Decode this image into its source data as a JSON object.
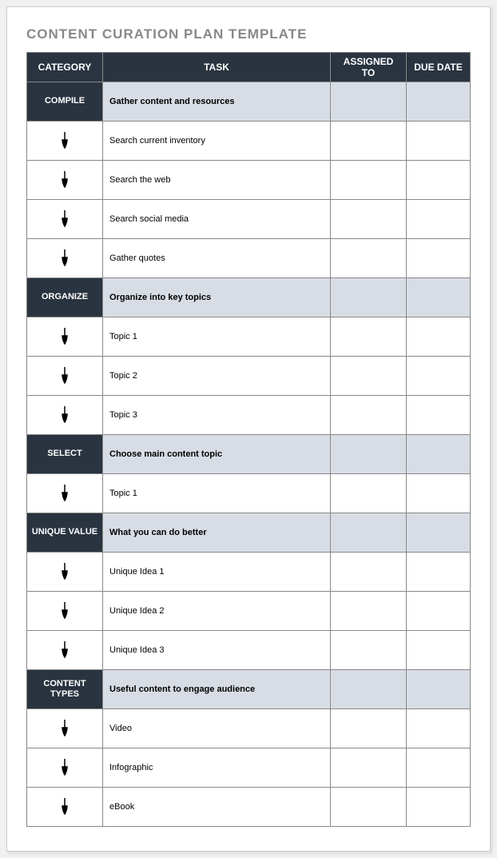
{
  "title": "CONTENT CURATION PLAN TEMPLATE",
  "columns": {
    "category": "CATEGORY",
    "task": "TASK",
    "assigned": "ASSIGNED TO",
    "due": "DUE DATE"
  },
  "sections": [
    {
      "category": "COMPILE",
      "header": "Gather content and resources",
      "rows": [
        {
          "task": "Search current inventory",
          "assigned": "",
          "due": ""
        },
        {
          "task": "Search the web",
          "assigned": "",
          "due": ""
        },
        {
          "task": "Search social media",
          "assigned": "",
          "due": ""
        },
        {
          "task": "Gather quotes",
          "assigned": "",
          "due": ""
        }
      ]
    },
    {
      "category": "ORGANIZE",
      "header": "Organize into key topics",
      "rows": [
        {
          "task": "Topic 1",
          "assigned": "",
          "due": ""
        },
        {
          "task": "Topic 2",
          "assigned": "",
          "due": ""
        },
        {
          "task": "Topic 3",
          "assigned": "",
          "due": ""
        }
      ]
    },
    {
      "category": "SELECT",
      "header": "Choose main content topic",
      "rows": [
        {
          "task": "Topic 1",
          "assigned": "",
          "due": ""
        }
      ]
    },
    {
      "category": "UNIQUE VALUE",
      "header": "What you can do better",
      "rows": [
        {
          "task": "Unique Idea 1",
          "assigned": "",
          "due": ""
        },
        {
          "task": "Unique Idea 2",
          "assigned": "",
          "due": ""
        },
        {
          "task": "Unique Idea 3",
          "assigned": "",
          "due": ""
        }
      ]
    },
    {
      "category": "CONTENT TYPES",
      "header": "Useful content to engage audience",
      "rows": [
        {
          "task": "Video",
          "assigned": "",
          "due": ""
        },
        {
          "task": "Infographic",
          "assigned": "",
          "due": ""
        },
        {
          "task": "eBook",
          "assigned": "",
          "due": ""
        }
      ]
    }
  ]
}
